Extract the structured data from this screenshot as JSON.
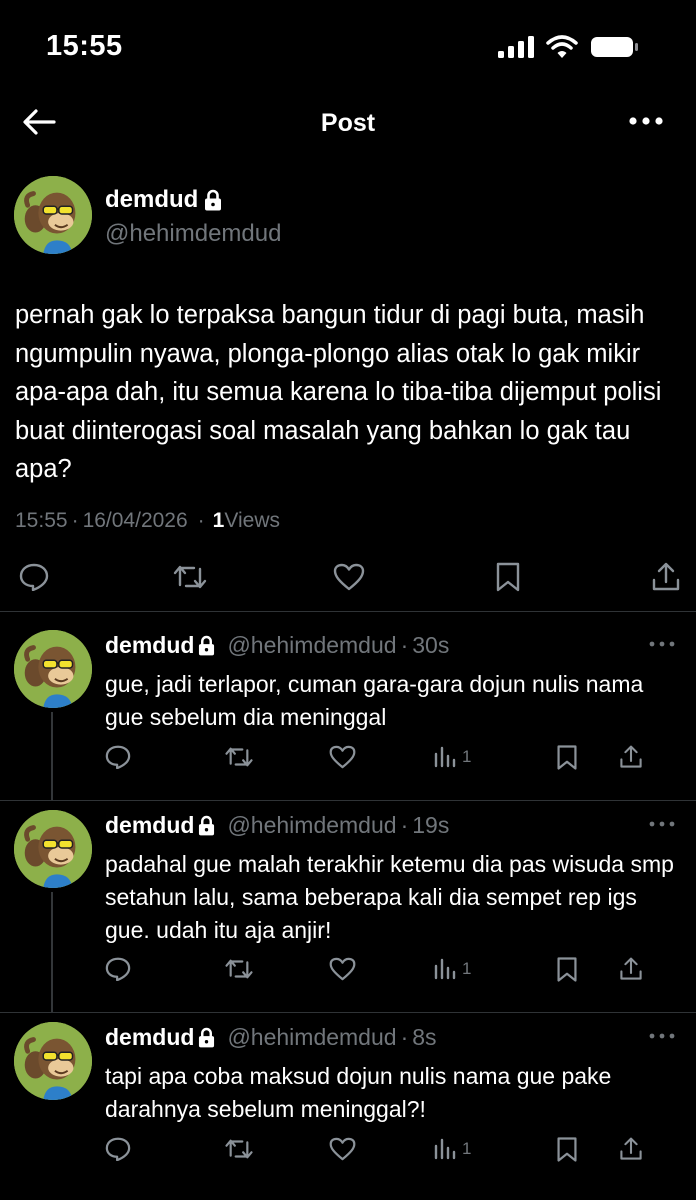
{
  "status_bar": {
    "time": "15:55"
  },
  "header": {
    "title": "Post"
  },
  "main_post": {
    "display_name": "demdud",
    "handle": "@hehimdemdud",
    "text": "pernah gak lo terpaksa bangun tidur di pagi buta, masih ngumpulin nyawa, plonga-plongo alias otak lo gak mikir apa-apa dah, itu semua karena lo tiba-tiba dijemput polisi buat diinterogasi soal masalah yang bahkan lo gak tau apa?",
    "time": "15:55",
    "dot1": "·",
    "date": "16/04/2026",
    "dot2": "·",
    "views_count": "1",
    "views_label": "Views"
  },
  "replies": [
    {
      "display_name": "demdud",
      "handle": "@hehimdemdud",
      "dot": "·",
      "time": "30s",
      "text": "gue, jadi terlapor, cuman gara-gara dojun nulis nama gue sebelum dia meninggal",
      "views": "1"
    },
    {
      "display_name": "demdud",
      "handle": "@hehimdemdud",
      "dot": "·",
      "time": "19s",
      "text": "padahal gue malah terakhir ketemu dia pas wisuda smp setahun lalu, sama beberapa kali dia sempet rep igs gue. udah itu aja anjir!",
      "views": "1"
    },
    {
      "display_name": "demdud",
      "handle": "@hehimdemdud",
      "dot": "·",
      "time": "8s",
      "text": "tapi apa coba maksud dojun nulis nama gue pake darahnya sebelum meninggal?!",
      "views": "1"
    }
  ],
  "colors": {
    "background": "#000000",
    "text": "#ffffff",
    "secondary": "#71767b",
    "divider": "#2f3336",
    "avatar_bg": "#8db04a"
  }
}
